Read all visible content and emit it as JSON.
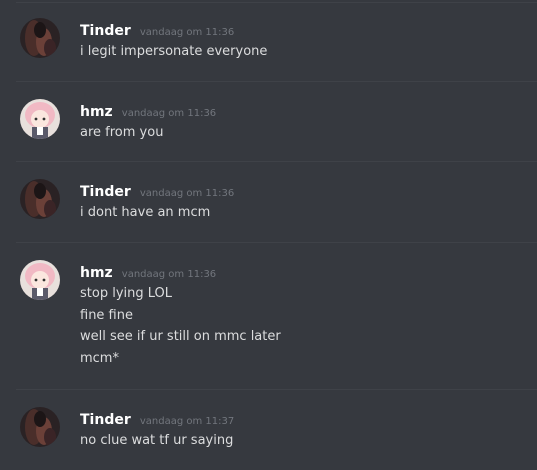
{
  "messages": [
    {
      "author": "Tinder",
      "timestamp": "vandaag om 11:36",
      "avatar": "dark-avatar",
      "lines": [
        "i legit impersonate everyone"
      ]
    },
    {
      "author": "hmz",
      "timestamp": "vandaag om 11:36",
      "avatar": "anime-avatar",
      "lines": [
        "are from you"
      ]
    },
    {
      "author": "Tinder",
      "timestamp": "vandaag om 11:36",
      "avatar": "dark-avatar",
      "lines": [
        "i dont have an mcm"
      ]
    },
    {
      "author": "hmz",
      "timestamp": "vandaag om 11:36",
      "avatar": "anime-avatar",
      "lines": [
        "stop lying LOL",
        "fine fine",
        "well see if ur still on mmc later",
        "mcm*"
      ]
    },
    {
      "author": "Tinder",
      "timestamp": "vandaag om 11:37",
      "avatar": "dark-avatar",
      "lines": [
        "no clue wat tf ur saying"
      ]
    }
  ],
  "colors": {
    "background": "#36393f",
    "username": "#ffffff",
    "timestamp": "#72767d",
    "text": "#dcddde"
  }
}
